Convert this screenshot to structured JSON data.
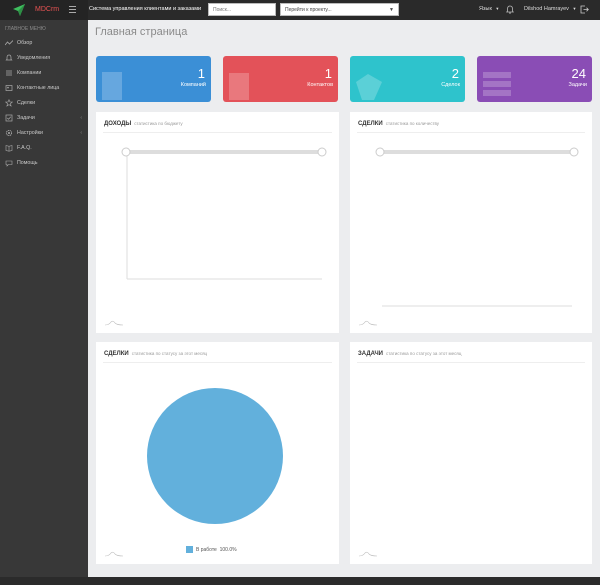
{
  "header": {
    "brand": "MDCrm",
    "system_title": "Система управления клиентами и заказами",
    "search_placeholder": "Поиск...",
    "project_select": "Перейти к проекту...",
    "lang": "Язык",
    "user": "Dilshod Hamrayev"
  },
  "sidebar": {
    "heading": "ГЛАВНОЕ МЕНЮ",
    "items": [
      {
        "label": "Обзор",
        "icon": "chart-line-icon"
      },
      {
        "label": "Уведомления",
        "icon": "bell-icon"
      },
      {
        "label": "Компании",
        "icon": "list-icon"
      },
      {
        "label": "Контактные лица",
        "icon": "contacts-icon"
      },
      {
        "label": "Сделки",
        "icon": "star-icon"
      },
      {
        "label": "Задачи",
        "icon": "tasks-icon"
      },
      {
        "label": "Настройки",
        "icon": "gear-icon"
      },
      {
        "label": "F.A.Q.",
        "icon": "book-icon"
      },
      {
        "label": "Помощь",
        "icon": "help-icon"
      }
    ]
  },
  "page": {
    "title": "Главная страница"
  },
  "stats": [
    {
      "value": "1",
      "label": "Компаний",
      "color": "#3b8fd6"
    },
    {
      "value": "1",
      "label": "Контактов",
      "color": "#e35259"
    },
    {
      "value": "2",
      "label": "Сделок",
      "color": "#2ec3cc"
    },
    {
      "value": "24",
      "label": "Задачи",
      "color": "#8a4db5"
    }
  ],
  "panels": {
    "income": {
      "title": "ДОХОДЫ",
      "subtitle": "статистика по бюджету"
    },
    "deals_count": {
      "title": "СДЕЛКИ",
      "subtitle": "статистика по количеству"
    },
    "deals_status": {
      "title": "СДЕЛКИ",
      "subtitle": "статистика по статусу за этот месяц"
    },
    "tasks_status": {
      "title": "ЗАДАЧИ",
      "subtitle": "статистика по статусу за этот месяц"
    }
  },
  "chart_data": {
    "type": "pie",
    "categories": [
      "В работе"
    ],
    "values": [
      100.0
    ],
    "legend": [
      {
        "name": "В работе",
        "percent": "100.0%",
        "color": "#62b0dc"
      }
    ]
  }
}
